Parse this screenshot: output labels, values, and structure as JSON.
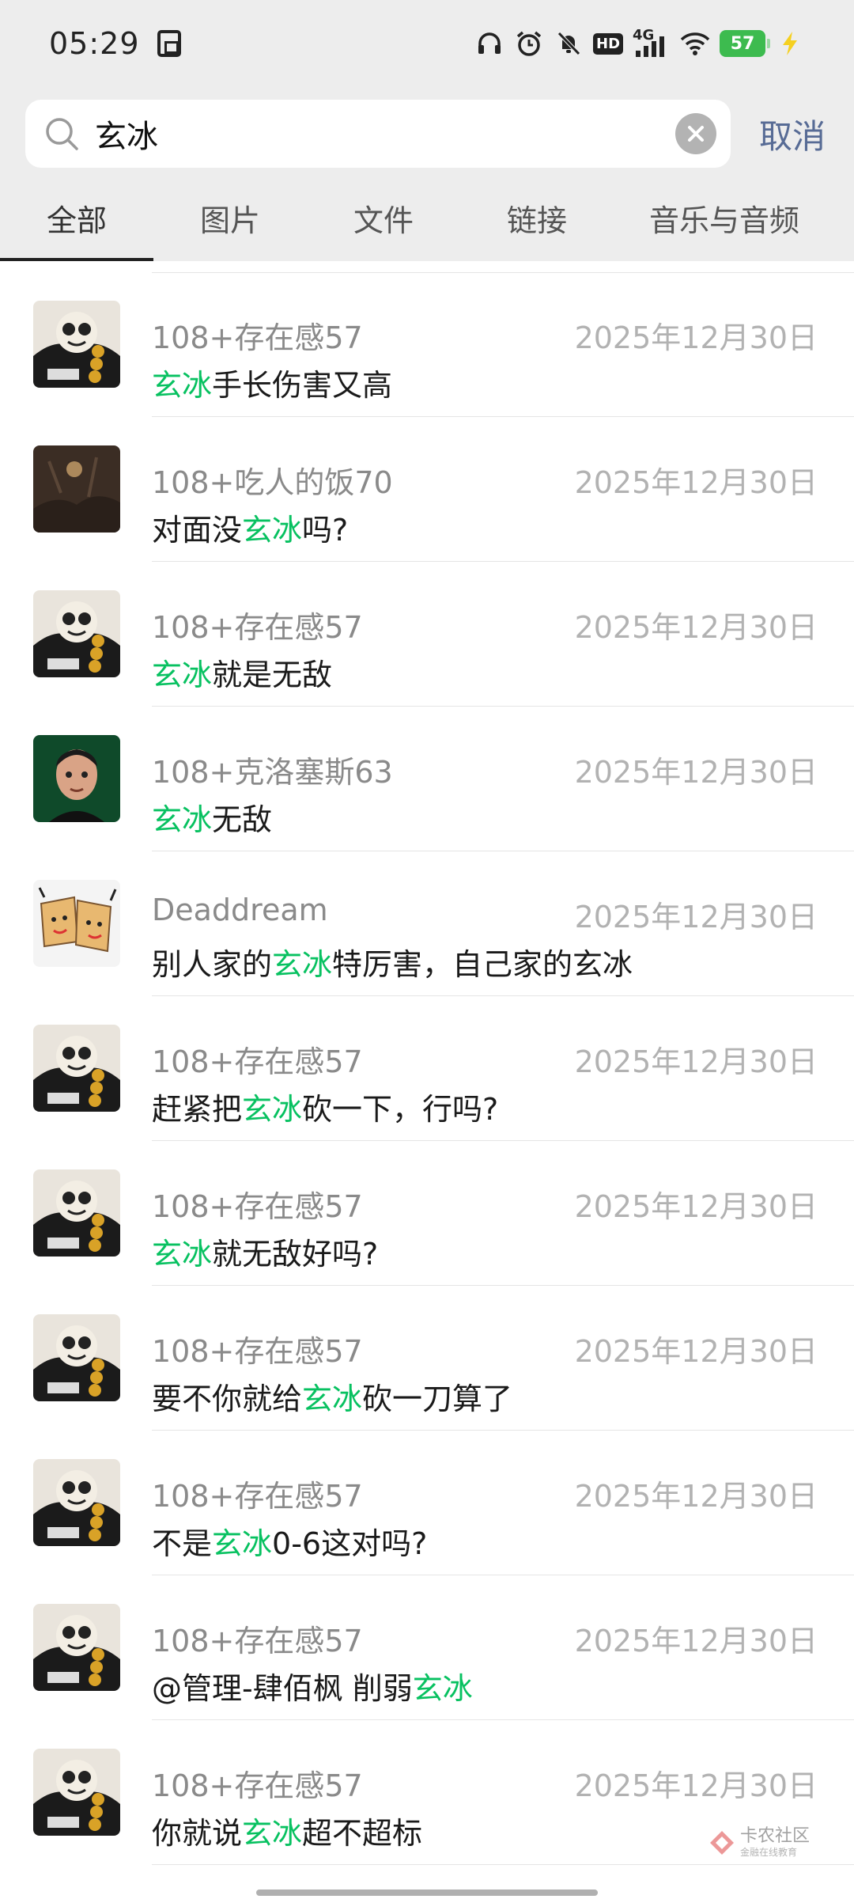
{
  "status_bar": {
    "time": "05:29",
    "network": "4G",
    "hd_label": "HD",
    "battery": "57"
  },
  "search": {
    "query": "玄冰",
    "cancel_label": "取消"
  },
  "tabs": [
    {
      "label": "全部",
      "active": true
    },
    {
      "label": "图片",
      "active": false
    },
    {
      "label": "文件",
      "active": false
    },
    {
      "label": "链接",
      "active": false
    },
    {
      "label": "音乐与音频",
      "active": false
    }
  ],
  "results": [
    {
      "name": "108+存在感57",
      "date": "2025年12月30日",
      "pre": "",
      "hl": "玄冰",
      "post": "手长伤害又高"
    },
    {
      "name": "108+吃人的饭70",
      "date": "2025年12月30日",
      "pre": "对面没",
      "hl": "玄冰",
      "post": "吗?"
    },
    {
      "name": "108+存在感57",
      "date": "2025年12月30日",
      "pre": "",
      "hl": "玄冰",
      "post": "就是无敌"
    },
    {
      "name": "108+克洛塞斯63",
      "date": "2025年12月30日",
      "pre": "",
      "hl": "玄冰",
      "post": "无敌"
    },
    {
      "name": "Deaddream",
      "date": "2025年12月30日",
      "pre": "别人家的",
      "hl": "玄冰",
      "post": "特厉害，自己家的玄冰"
    },
    {
      "name": "108+存在感57",
      "date": "2025年12月30日",
      "pre": "赶紧把",
      "hl": "玄冰",
      "post": "砍一下，行吗?"
    },
    {
      "name": "108+存在感57",
      "date": "2025年12月30日",
      "pre": "",
      "hl": "玄冰",
      "post": "就无敌好吗?"
    },
    {
      "name": "108+存在感57",
      "date": "2025年12月30日",
      "pre": "要不你就给",
      "hl": "玄冰",
      "post": "砍一刀算了"
    },
    {
      "name": "108+存在感57",
      "date": "2025年12月30日",
      "pre": "不是",
      "hl": "玄冰",
      "post": "0-6这对吗?"
    },
    {
      "name": "108+存在感57",
      "date": "2025年12月30日",
      "pre": "@管理-肆佰枫 削弱",
      "hl": "玄冰",
      "post": ""
    },
    {
      "name": "108+存在感57",
      "date": "2025年12月30日",
      "pre": "你就说",
      "hl": "玄冰",
      "post": "超不超标"
    }
  ],
  "watermark": {
    "title": "卡农社区",
    "subtitle": "金融在线教育"
  }
}
